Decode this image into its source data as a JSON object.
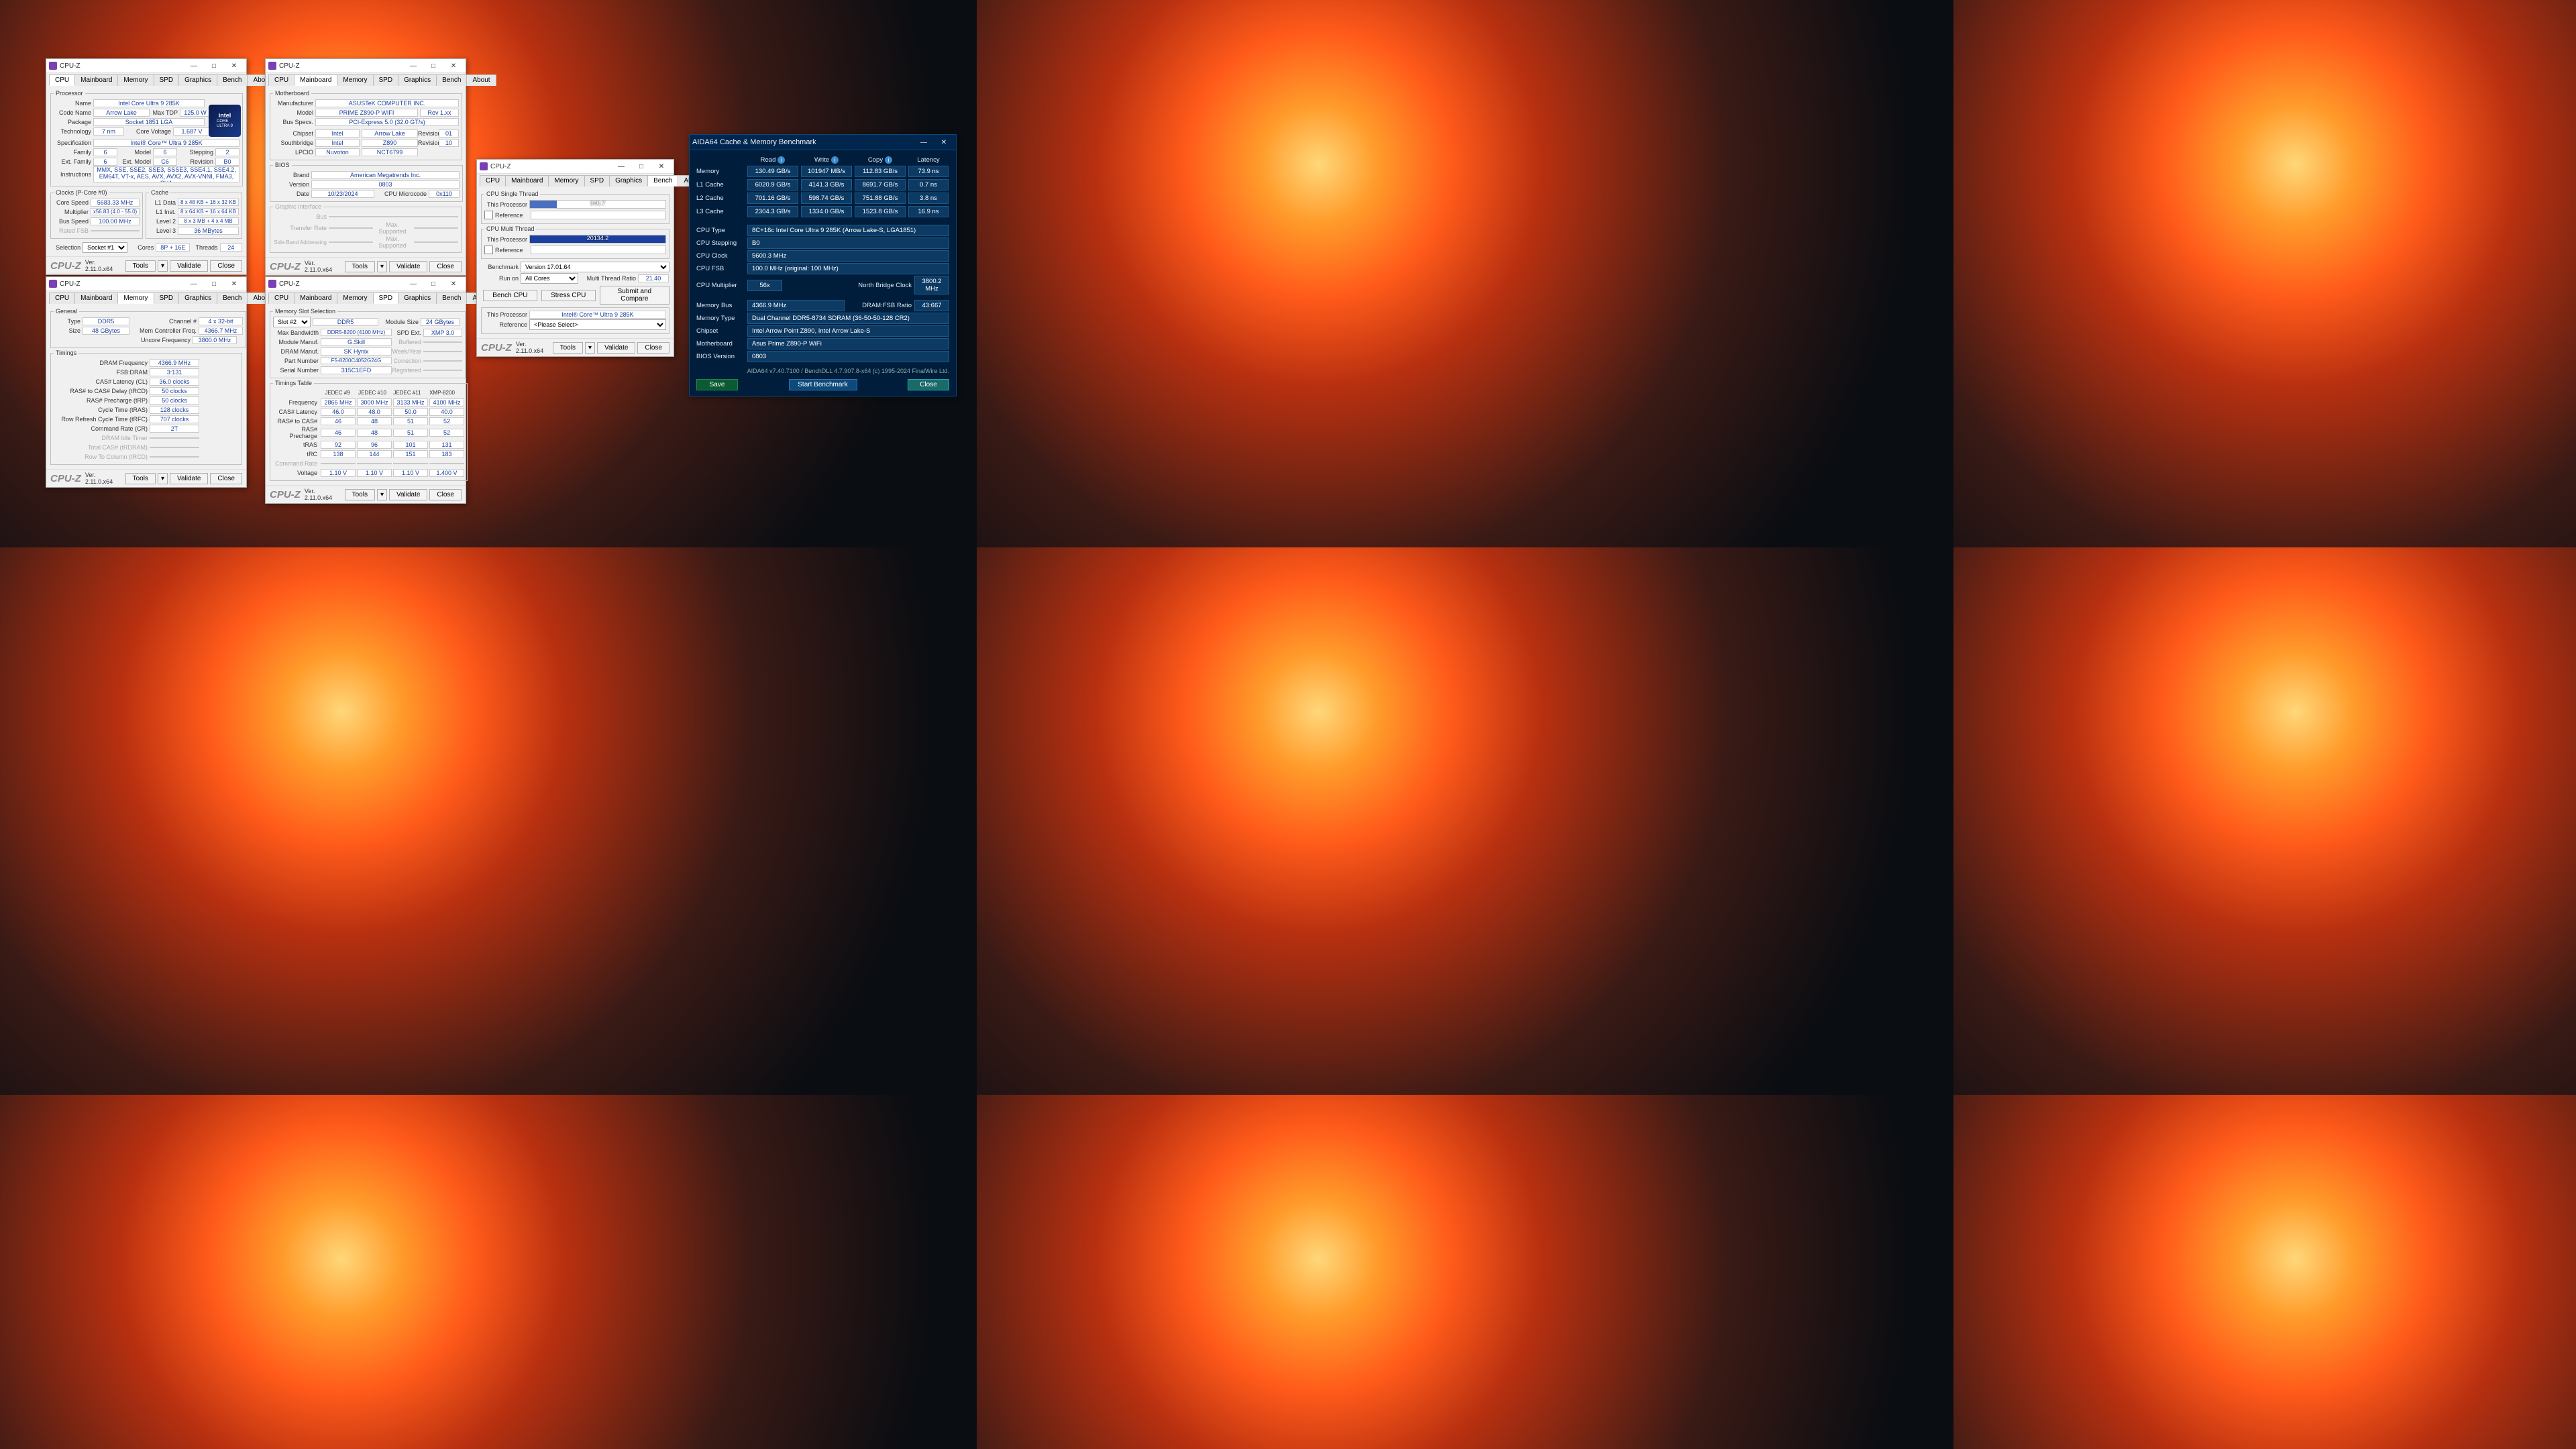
{
  "cpuz_title": "CPU-Z",
  "brand": "CPU-Z",
  "ver": "Ver. 2.11.0.x64",
  "btns": {
    "tools": "Tools",
    "validate": "Validate",
    "close": "Close",
    "benchcpu": "Bench CPU",
    "stress": "Stress CPU",
    "submit": "Submit and Compare",
    "save": "Save",
    "start": "Start Benchmark"
  },
  "tabs": {
    "cpu": "CPU",
    "mainboard": "Mainboard",
    "memory": "Memory",
    "spd": "SPD",
    "graphics": "Graphics",
    "bench": "Bench",
    "about": "About"
  },
  "winCPU": {
    "proc": {
      "name": "Intel Core Ultra 9 285K",
      "code": "Arrow Lake",
      "tdp": "125.0 W",
      "pkg": "Socket 1851 LGA",
      "tech": "7 nm",
      "volt": "1.687 V",
      "spec": "Intel® Core™ Ultra 9 285K",
      "fam": "6",
      "model": "6",
      "step": "2",
      "extfam": "6",
      "extmodel": "C6",
      "rev": "B0",
      "instr": "MMX, SSE, SSE2, SSE3, SSSE3, SSE4.1, SSE4.2, EM64T, VT-x, AES, AVX, AVX2, AVX-VNNI, FMA3, SHA"
    },
    "clocks": {
      "core": "5683.33 MHz",
      "mult": "x56.83 (4.0 - 55.0)",
      "bus": "100.00 MHz",
      "rated": ""
    },
    "cache": {
      "l1d": "8 x 48 KB + 16 x 32 KB",
      "l1i": "8 x 64 KB + 16 x 64 KB",
      "l2": "8 x 3 MB + 4 x 4 MB",
      "l3": "36 MBytes"
    },
    "sel": {
      "socket": "Socket #1",
      "cores": "8P + 16E",
      "threads": "24"
    }
  },
  "winMB": {
    "mb": {
      "manu": "ASUSTeK COMPUTER INC.",
      "model": "PRIME Z890-P WIFI",
      "modelrev": "Rev 1.xx",
      "bus": "PCI-Express 5.0 (32.0 GT/s)",
      "chipset": "Intel",
      "chipmodel": "Arrow Lake",
      "chiprev": "01",
      "sb": "Intel",
      "sbmodel": "Z890",
      "sbrev": "10",
      "lpcio": "Nuvoton",
      "lpcmodel": "NCT6799"
    },
    "bios": {
      "brand": "American Megatrends Inc.",
      "ver": "0803",
      "date": "10/23/2024",
      "ucode": "0x110"
    },
    "gi": {
      "bus": "",
      "rate": "",
      "maxsup": "Max. Supported",
      "sba": "",
      "maxsup2": "Max. Supported"
    }
  },
  "winMem": {
    "gen": {
      "type": "DDR5",
      "chan": "4 x 32-bit",
      "size": "48 GBytes",
      "mcf": "4366.7 MHz",
      "uncore": "3800.0 MHz"
    },
    "tim": {
      "freq": "4366.9 MHz",
      "fsb": "3:131",
      "cl": "36.0 clocks",
      "trcd": "50 clocks",
      "trp": "50 clocks",
      "tras": "128 clocks",
      "trfc": "707 clocks",
      "cr": "2T",
      "idle": "",
      "tcas": "",
      "trrd": ""
    }
  },
  "winSPD": {
    "slot": "Slot #2",
    "dramtype": "DDR5",
    "modsize": "24 GBytes",
    "maxbw": "DDR5-8200 (4100 MHz)",
    "spdext": "XMP 3.0",
    "modmanu": "G.Skill",
    "drammanu": "SK Hynix",
    "part": "F5-8200C4052G24G",
    "serial": "315C1EFD",
    "tt": {
      "hdr": [
        "JEDEC #9",
        "JEDEC #10",
        "JEDEC #11",
        "XMP-8200"
      ],
      "rows": [
        [
          "Frequency",
          "2866 MHz",
          "3000 MHz",
          "3133 MHz",
          "4100 MHz"
        ],
        [
          "CAS# Latency",
          "46.0",
          "48.0",
          "50.0",
          "40.0"
        ],
        [
          "RAS# to CAS#",
          "46",
          "48",
          "51",
          "52"
        ],
        [
          "RAS# Precharge",
          "46",
          "48",
          "51",
          "52"
        ],
        [
          "tRAS",
          "92",
          "96",
          "101",
          "131"
        ],
        [
          "tRC",
          "138",
          "144",
          "151",
          "183"
        ],
        [
          "Command Rate",
          "",
          "",
          "",
          ""
        ],
        [
          "Voltage",
          "1.10 V",
          "1.10 V",
          "1.10 V",
          "1.400 V"
        ]
      ]
    }
  },
  "winBench": {
    "st": {
      "lbl": "CPU Single Thread",
      "proc": "This Processor",
      "ref": "Reference",
      "score": "940.7"
    },
    "mt": {
      "lbl": "CPU Multi Thread",
      "proc": "This Processor",
      "ref": "Reference",
      "score": "20134.2"
    },
    "set": {
      "bench": "Benchmark",
      "ver": "Version 17.01.64",
      "run": "Run on",
      "all": "All Cores",
      "mtr": "Multi Thread Ratio",
      "ratio": "21.40"
    },
    "thisproc": "Intel® Core™ Ultra 9 285K",
    "refsel": "<Please Select>"
  },
  "aida": {
    "title": "AIDA64 Cache & Memory Benchmark",
    "hdr": [
      "Read",
      "Write",
      "Copy",
      "Latency"
    ],
    "rows": [
      [
        "Memory",
        "130.49 GB/s",
        "101947 MB/s",
        "112.83 GB/s",
        "73.9 ns"
      ],
      [
        "L1 Cache",
        "6020.9 GB/s",
        "4141.3 GB/s",
        "8691.7 GB/s",
        "0.7 ns"
      ],
      [
        "L2 Cache",
        "701.16 GB/s",
        "598.74 GB/s",
        "751.88 GB/s",
        "3.8 ns"
      ],
      [
        "L3 Cache",
        "2304.3 GB/s",
        "1334.0 GB/s",
        "1523.8 GB/s",
        "16.9 ns"
      ]
    ],
    "info": [
      [
        "CPU Type",
        "8C+16c Intel Core Ultra 9 285K  (Arrow Lake-S, LGA1851)"
      ],
      [
        "CPU Stepping",
        "B0"
      ],
      [
        "CPU Clock",
        "5600.3 MHz"
      ],
      [
        "CPU FSB",
        "100.0 MHz  (original: 100 MHz)"
      ]
    ],
    "mult": {
      "l": "CPU Multiplier",
      "v": "56x",
      "r": "North Bridge Clock",
      "rv": "3800.2 MHz"
    },
    "info2": [
      [
        "Memory Bus",
        "4366.9 MHz",
        "DRAM:FSB Ratio",
        "43:667"
      ],
      [
        "Memory Type",
        "Dual Channel DDR5-8734 SDRAM  (36-50-50-128 CR2)",
        "",
        ""
      ],
      [
        "Chipset",
        "Intel Arrow Point Z890, Intel Arrow Lake-S",
        "",
        ""
      ],
      [
        "Motherboard",
        "Asus Prime Z890-P WiFi",
        "",
        ""
      ],
      [
        "BIOS Version",
        "0803",
        "",
        ""
      ]
    ],
    "foot": "AIDA64 v7.40.7100 / BenchDLL 4.7.907.8-x64  (c) 1995-2024 FinalWire Ltd."
  },
  "labels": {
    "name": "Name",
    "code": "Code Name",
    "tdp": "Max TDP",
    "pkg": "Package",
    "tech": "Technology",
    "volt": "Core Voltage",
    "spec": "Specification",
    "fam": "Family",
    "model": "Model",
    "step": "Stepping",
    "extfam": "Ext. Family",
    "extmodel": "Ext. Model",
    "rev": "Revision",
    "instr": "Instructions",
    "clocks": "Clocks (P-Core #0)",
    "corespeed": "Core Speed",
    "mult": "Multiplier",
    "busspeed": "Bus Speed",
    "rated": "Rated FSB",
    "cache": "Cache",
    "l1d": "L1 Data",
    "l1i": "L1 Inst.",
    "l2": "Level 2",
    "l3": "Level 3",
    "sel": "Selection",
    "cores": "Cores",
    "threads": "Threads",
    "mb": "Motherboard",
    "manu": "Manufacturer",
    "busspecs": "Bus Specs.",
    "chipset": "Chipset",
    "sb": "Southbridge",
    "lpcio": "LPCIO",
    "bios": "BIOS",
    "brand2": "Brand",
    "version": "Version",
    "date": "Date",
    "ucode": "CPU Microcode",
    "gi": "Graphic Interface",
    "gibus": "Bus",
    "girate": "Transfer Rate",
    "gisba": "Side Band Addressing",
    "gen": "General",
    "type": "Type",
    "chan": "Channel #",
    "size": "Size",
    "mcf": "Mem Controller Freq.",
    "uncore": "Uncore Frequency",
    "tim": "Timings",
    "dramf": "DRAM Frequency",
    "fsbdram": "FSB:DRAM",
    "cl": "CAS# Latency (CL)",
    "trcd": "RAS# to CAS# Delay (tRCD)",
    "trp": "RAS# Precharge (tRP)",
    "tras": "Cycle Time (tRAS)",
    "trfc": "Row Refresh Cycle Time (tRFC)",
    "cr": "Command Rate (CR)",
    "idle": "DRAM Idle Timer",
    "tcas": "Total CAS# (tRDRAM)",
    "trrd": "Row To Column (tRCD)",
    "mss": "Memory Slot Selection",
    "modsize": "Module Size",
    "maxbw": "Max Bandwidth",
    "spdext": "SPD Ext.",
    "modmanu": "Module Manuf.",
    "buffered": "Buffered",
    "drammanu": "DRAM Manuf.",
    "weekyear": "Week/Year",
    "part": "Part Number",
    "correction": "Correction",
    "serial": "Serial Number",
    "registered": "Registered",
    "tt": "Timings Table",
    "proc": "Processor",
    "thisproc": "This Processor",
    "reference": "Reference"
  }
}
